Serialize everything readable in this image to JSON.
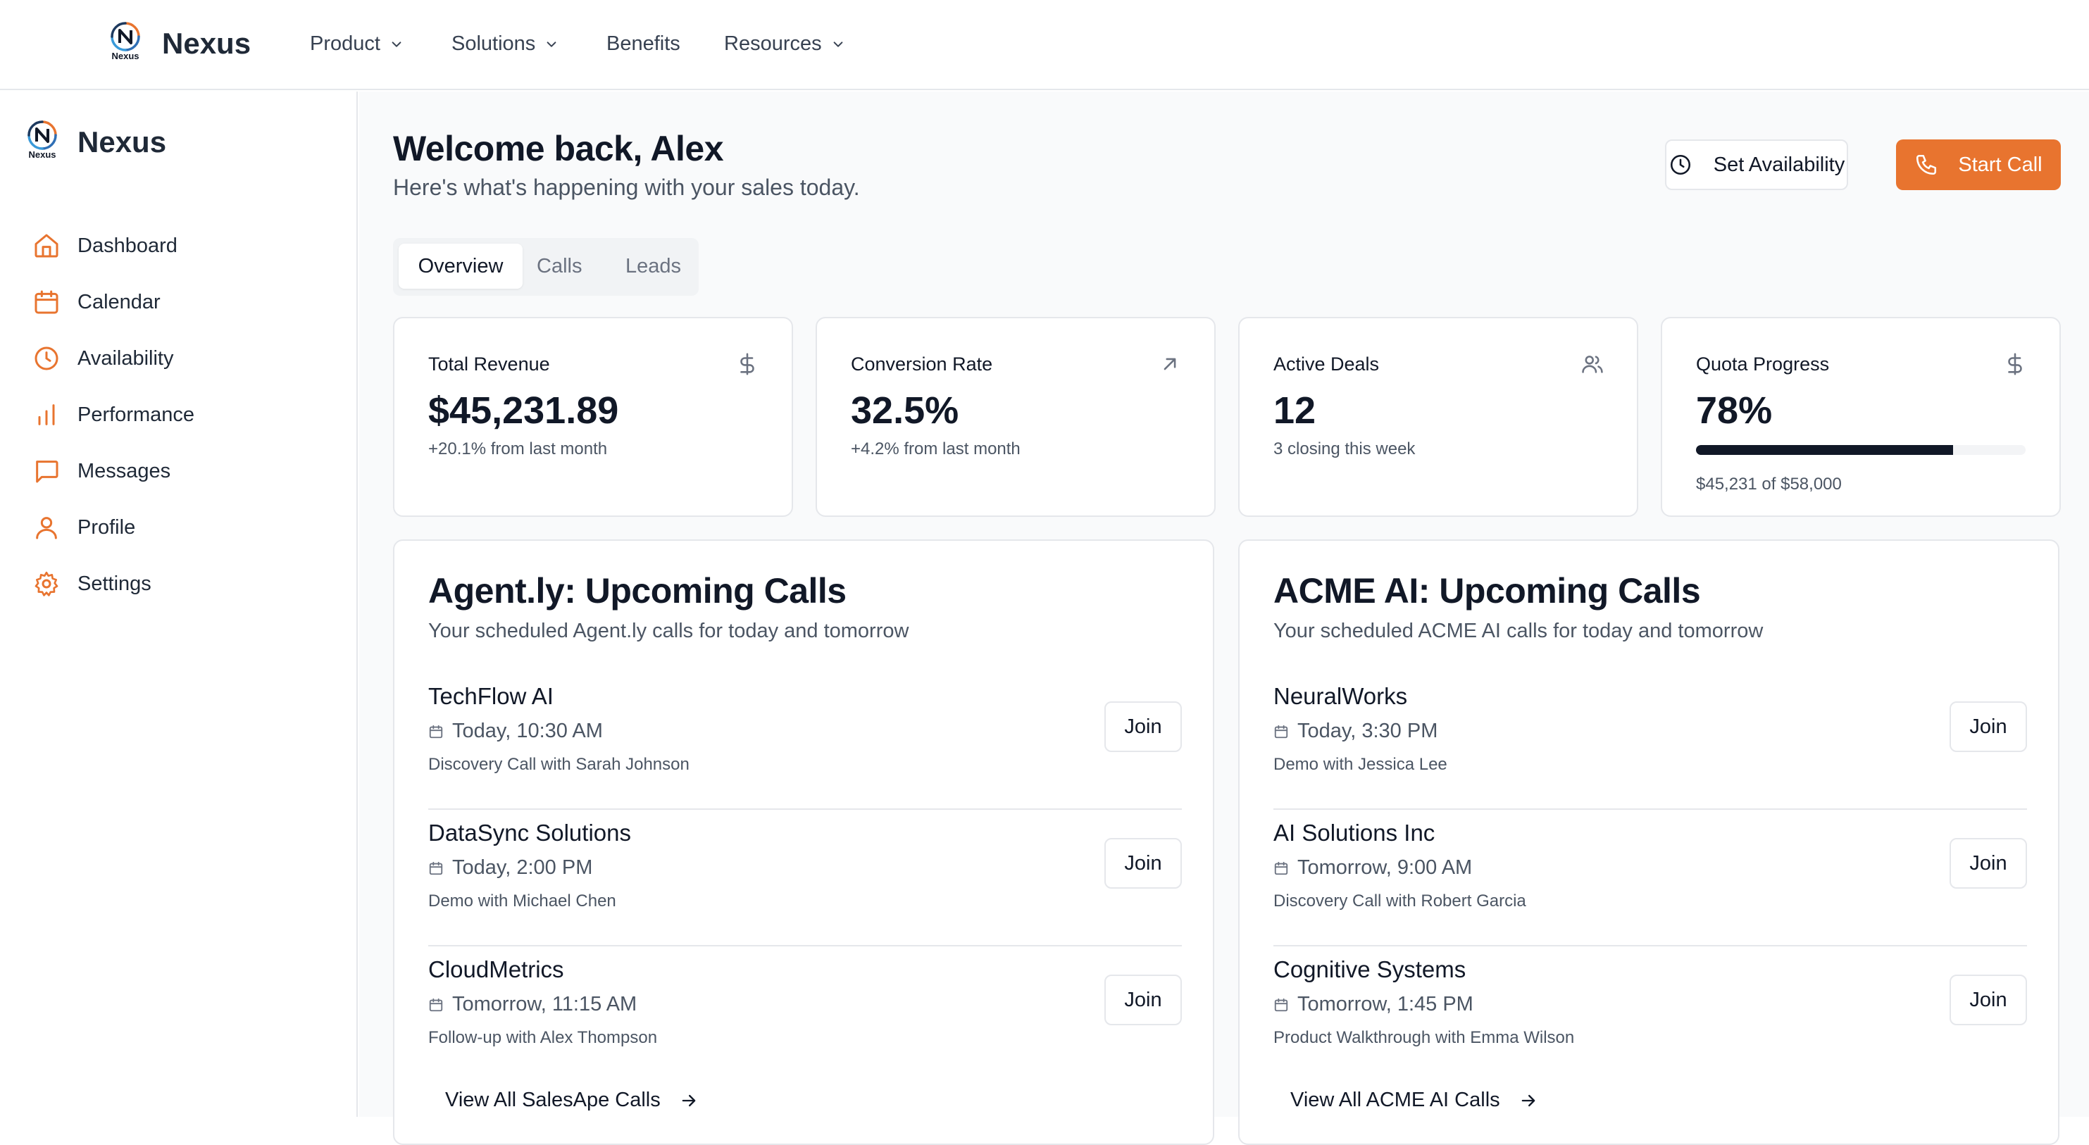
{
  "topnav": {
    "brand": "Nexus",
    "logo_text": "Nexus",
    "items": [
      {
        "label": "Product",
        "has_dropdown": true
      },
      {
        "label": "Solutions",
        "has_dropdown": true
      },
      {
        "label": "Benefits",
        "has_dropdown": false
      },
      {
        "label": "Resources",
        "has_dropdown": true
      }
    ]
  },
  "sidebar": {
    "brand": "Nexus",
    "logo_text": "Nexus",
    "accent_color": "#e8742f",
    "items": [
      {
        "label": "Dashboard",
        "icon": "home-icon"
      },
      {
        "label": "Calendar",
        "icon": "calendar-icon"
      },
      {
        "label": "Availability",
        "icon": "clock-icon"
      },
      {
        "label": "Performance",
        "icon": "bar-chart-icon"
      },
      {
        "label": "Messages",
        "icon": "message-icon"
      },
      {
        "label": "Profile",
        "icon": "user-icon"
      },
      {
        "label": "Settings",
        "icon": "gear-icon"
      }
    ]
  },
  "header": {
    "title": "Welcome back, Alex",
    "subtitle": "Here's what's happening with your sales today.",
    "set_availability_label": "Set Availability",
    "start_call_label": "Start Call",
    "start_call_color": "#e8742f"
  },
  "tabs": [
    {
      "label": "Overview",
      "active": true
    },
    {
      "label": "Calls",
      "active": false
    },
    {
      "label": "Leads",
      "active": false
    }
  ],
  "stats": [
    {
      "label": "Total Revenue",
      "value": "$45,231.89",
      "note": "+20.1% from last month",
      "icon": "dollar-icon"
    },
    {
      "label": "Conversion Rate",
      "value": "32.5%",
      "note": "+4.2% from last month",
      "icon": "arrow-up-right-icon"
    },
    {
      "label": "Active Deals",
      "value": "12",
      "note": "3 closing this week",
      "icon": "users-icon"
    },
    {
      "label": "Quota Progress",
      "value": "78%",
      "note": "$45,231 of $58,000",
      "icon": "dollar-icon",
      "progress": 0.78
    }
  ],
  "panels": [
    {
      "title": "Agent.ly: Upcoming Calls",
      "subtitle": "Your scheduled Agent.ly calls for today and tomorrow",
      "calls": [
        {
          "company": "TechFlow AI",
          "time": "Today, 10:30 AM",
          "desc": "Discovery Call with Sarah Johnson",
          "join": "Join"
        },
        {
          "company": "DataSync Solutions",
          "time": "Today, 2:00 PM",
          "desc": "Demo with Michael Chen",
          "join": "Join"
        },
        {
          "company": "CloudMetrics",
          "time": "Tomorrow, 11:15 AM",
          "desc": "Follow-up with Alex Thompson",
          "join": "Join"
        }
      ],
      "view_all": "View All SalesApe Calls"
    },
    {
      "title": "ACME AI: Upcoming Calls",
      "subtitle": "Your scheduled ACME AI calls for today and tomorrow",
      "calls": [
        {
          "company": "NeuralWorks",
          "time": "Today, 3:30 PM",
          "desc": "Demo with Jessica Lee",
          "join": "Join"
        },
        {
          "company": "AI Solutions Inc",
          "time": "Tomorrow, 9:00 AM",
          "desc": "Discovery Call with Robert Garcia",
          "join": "Join"
        },
        {
          "company": "Cognitive Systems",
          "time": "Tomorrow, 1:45 PM",
          "desc": "Product Walkthrough with Emma Wilson",
          "join": "Join"
        }
      ],
      "view_all": "View All ACME AI Calls"
    }
  ]
}
